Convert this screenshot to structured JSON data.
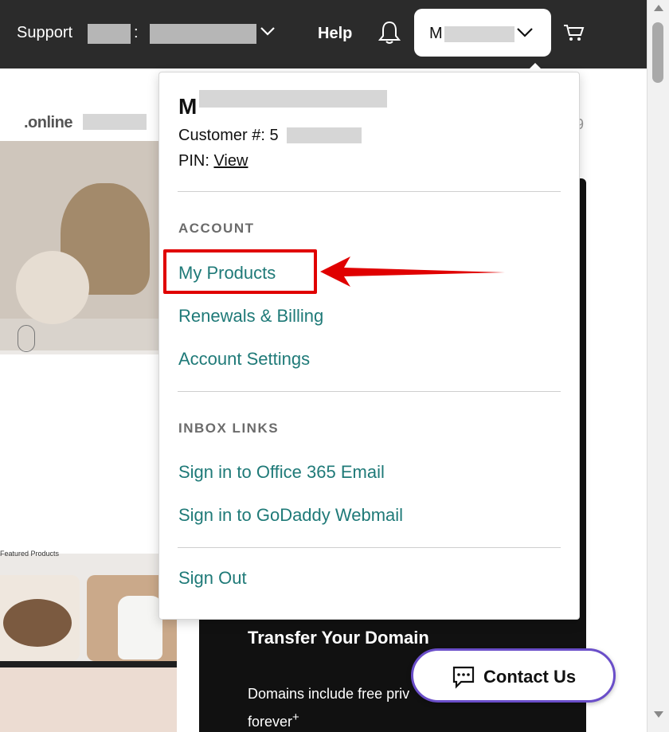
{
  "header": {
    "support_label": "Support",
    "support_separator": ":",
    "help_label": "Help",
    "account_initial": "M",
    "icons": {
      "bell": "bell-icon",
      "cart": "cart-icon",
      "chevron": "chevron-down-icon"
    }
  },
  "background": {
    "domain_text": ".online",
    "domain_tail": "9",
    "featured_label": "Featured Products",
    "transfer_title": "Transfer Your Domain",
    "transfer_body": "Domains include free priv",
    "transfer_body_2": "forever",
    "transfer_body_sup": "+"
  },
  "dropdown": {
    "user_initial": "M",
    "customer_label": "Customer #: 5",
    "pin_label": "PIN: ",
    "pin_link": "View",
    "account_section": "ACCOUNT",
    "account_links": [
      "My Products",
      "Renewals & Billing",
      "Account Settings"
    ],
    "inbox_section": "INBOX LINKS",
    "inbox_links": [
      "Sign in to Office 365 Email",
      "Sign in to GoDaddy Webmail"
    ],
    "sign_out": "Sign Out"
  },
  "contact": {
    "label": "Contact Us",
    "icon": "chat-bubble-icon"
  },
  "annotation": {
    "highlight_color": "#e00000"
  },
  "colors": {
    "topbar": "#2b2b2b",
    "link": "#1f7a78",
    "contact_border": "#6a4ec9"
  }
}
